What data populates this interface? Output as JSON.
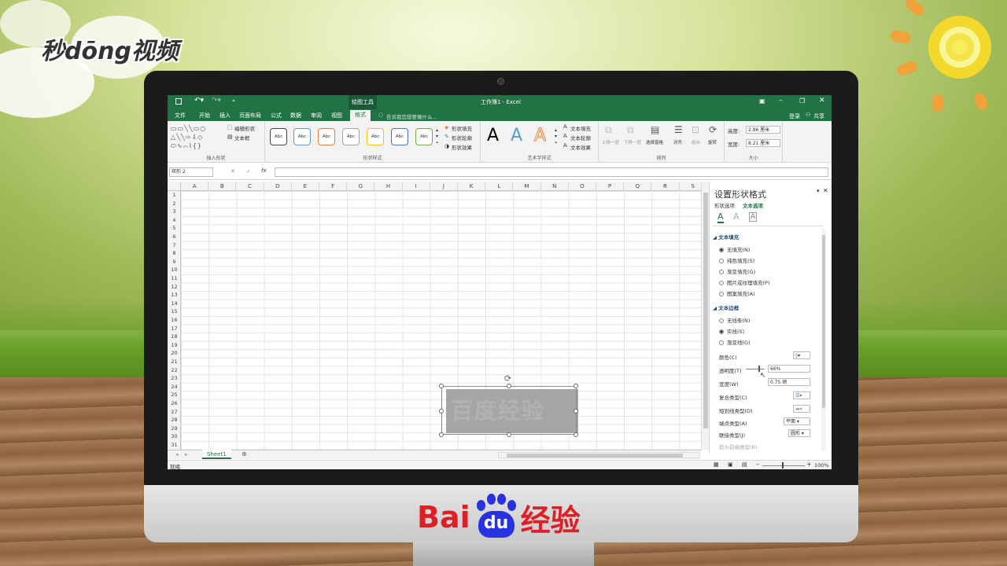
{
  "watermark": {
    "logo_text": "秒dōng视频",
    "footer_brand_bai": "Bai",
    "footer_brand_du": "du",
    "footer_brand_cn": "经验"
  },
  "titlebar": {
    "drawing_tools": "绘图工具",
    "title": "工作簿1 - Excel",
    "signin": "登录",
    "share": "共享"
  },
  "tabs": [
    {
      "label": "文件"
    },
    {
      "label": "开始"
    },
    {
      "label": "插入"
    },
    {
      "label": "页面布局"
    },
    {
      "label": "公式"
    },
    {
      "label": "数据"
    },
    {
      "label": "审阅"
    },
    {
      "label": "视图"
    },
    {
      "label": "格式"
    }
  ],
  "tell_me": "告诉我您想要做什么...",
  "ribbon": {
    "insert_shapes_label": "插入形状",
    "edit_shape": "编辑形状",
    "text_box": "文本框",
    "shape_styles_label": "形状样式",
    "style_sample": "Abc",
    "shape_fill": "形状填充",
    "shape_outline": "形状轮廓",
    "shape_effects": "形状效果",
    "wordart_label": "艺术字样式",
    "wordart_sample": "A",
    "text_fill": "文本填充",
    "text_outline": "文本轮廓",
    "text_effects": "文本效果",
    "arrange_label": "排列",
    "bring_forward": "上移一层",
    "send_backward": "下移一层",
    "selection_pane": "选择窗格",
    "align": "对齐",
    "group": "组合",
    "rotate": "旋转",
    "size_label": "大小",
    "height_label": "高度:",
    "height_value": "2.86 厘米",
    "width_label": "宽度:",
    "width_value": "8.21 厘米"
  },
  "formula_bar": {
    "name_box": "矩形 2",
    "cancel": "✕",
    "enter": "✓",
    "fx": "fx"
  },
  "columns": [
    "A",
    "B",
    "C",
    "D",
    "E",
    "F",
    "G",
    "H",
    "I",
    "J",
    "K",
    "L",
    "M",
    "N",
    "O",
    "P",
    "Q",
    "R",
    "S"
  ],
  "rows": [
    "1",
    "2",
    "3",
    "4",
    "5",
    "6",
    "7",
    "8",
    "9",
    "10",
    "11",
    "12",
    "13",
    "14",
    "15",
    "16",
    "17",
    "18",
    "19",
    "20",
    "21",
    "22",
    "23",
    "24",
    "25",
    "26",
    "27",
    "28",
    "29",
    "30",
    "31"
  ],
  "shape_text": "百度经验",
  "sheet_tab": "Sheet1",
  "status": {
    "ready": "就绪",
    "zoom": "100%"
  },
  "pane": {
    "title": "设置形状格式",
    "tab_shape": "形状选项",
    "tab_text": "文本选项",
    "text_fill_section": "文本填充",
    "fill_options": [
      {
        "label": "无填充(N)",
        "selected": true
      },
      {
        "label": "纯色填充(S)",
        "selected": false
      },
      {
        "label": "渐变填充(G)",
        "selected": false
      },
      {
        "label": "图片或纹理填充(P)",
        "selected": false
      },
      {
        "label": "图案填充(A)",
        "selected": false
      }
    ],
    "text_outline_section": "文本边框",
    "outline_options": [
      {
        "label": "无线条(N)",
        "selected": false
      },
      {
        "label": "实线(S)",
        "selected": true
      },
      {
        "label": "渐变线(G)",
        "selected": false
      }
    ],
    "color_label": "颜色(C)",
    "transparency_label": "透明度(T)",
    "transparency_value": "66%",
    "width_label": "宽度(W)",
    "width_value": "0.75 磅",
    "compound_label": "复合类型(C)",
    "dash_label": "短划线类型(D)",
    "cap_label": "端点类型(A)",
    "cap_value": "平面",
    "join_label": "联接类型(J)",
    "join_value": "圆形",
    "arrow_label": "箭头前端类型(B)"
  },
  "colors": {
    "excel_green": "#217346",
    "shape_fill": "#a6a6a6",
    "baidu_red": "#de1f26",
    "baidu_blue": "#2932e1"
  }
}
